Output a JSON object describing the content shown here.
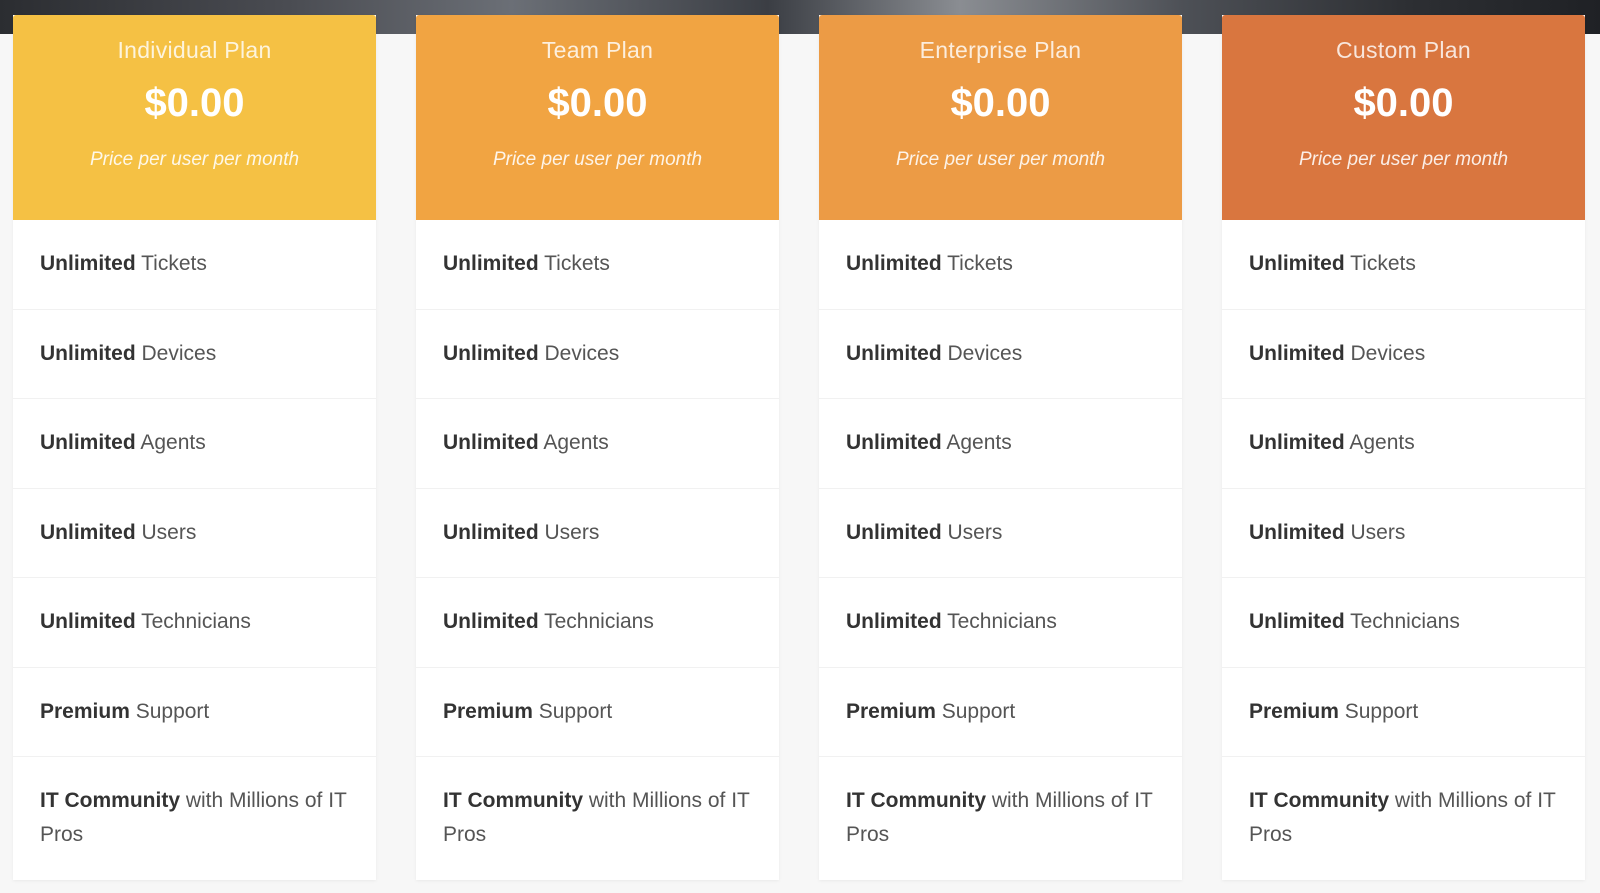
{
  "colors": {
    "individual": "#f5c144",
    "team": "#f1a442",
    "enterprise": "#ec9b45",
    "custom": "#d9763f"
  },
  "plans": [
    {
      "name": "Individual Plan",
      "price": "$0.00",
      "price_note": "Price per user per month",
      "features": [
        {
          "bold": "Unlimited",
          "text": " Tickets"
        },
        {
          "bold": "Unlimited",
          "text": " Devices"
        },
        {
          "bold": "Unlimited",
          "text": " Agents"
        },
        {
          "bold": "Unlimited",
          "text": " Users"
        },
        {
          "bold": "Unlimited",
          "text": " Technicians"
        },
        {
          "bold": "Premium",
          "text": " Support"
        },
        {
          "bold": "IT Community",
          "text": " with Millions of IT Pros"
        }
      ]
    },
    {
      "name": "Team Plan",
      "price": "$0.00",
      "price_note": "Price per user per month",
      "features": [
        {
          "bold": "Unlimited",
          "text": " Tickets"
        },
        {
          "bold": "Unlimited",
          "text": " Devices"
        },
        {
          "bold": "Unlimited",
          "text": " Agents"
        },
        {
          "bold": "Unlimited",
          "text": " Users"
        },
        {
          "bold": "Unlimited",
          "text": " Technicians"
        },
        {
          "bold": "Premium",
          "text": " Support"
        },
        {
          "bold": "IT Community",
          "text": " with Millions of IT Pros"
        }
      ]
    },
    {
      "name": "Enterprise Plan",
      "price": "$0.00",
      "price_note": "Price per user per month",
      "features": [
        {
          "bold": "Unlimited",
          "text": " Tickets"
        },
        {
          "bold": "Unlimited",
          "text": " Devices"
        },
        {
          "bold": "Unlimited",
          "text": " Agents"
        },
        {
          "bold": "Unlimited",
          "text": " Users"
        },
        {
          "bold": "Unlimited",
          "text": " Technicians"
        },
        {
          "bold": "Premium",
          "text": " Support"
        },
        {
          "bold": "IT Community",
          "text": " with Millions of IT Pros"
        }
      ]
    },
    {
      "name": "Custom Plan",
      "price": "$0.00",
      "price_note": "Price per user per month",
      "features": [
        {
          "bold": "Unlimited",
          "text": " Tickets"
        },
        {
          "bold": "Unlimited",
          "text": " Devices"
        },
        {
          "bold": "Unlimited",
          "text": " Agents"
        },
        {
          "bold": "Unlimited",
          "text": " Users"
        },
        {
          "bold": "Unlimited",
          "text": " Technicians"
        },
        {
          "bold": "Premium",
          "text": " Support"
        },
        {
          "bold": "IT Community",
          "text": " with Millions of IT Pros"
        }
      ]
    }
  ]
}
